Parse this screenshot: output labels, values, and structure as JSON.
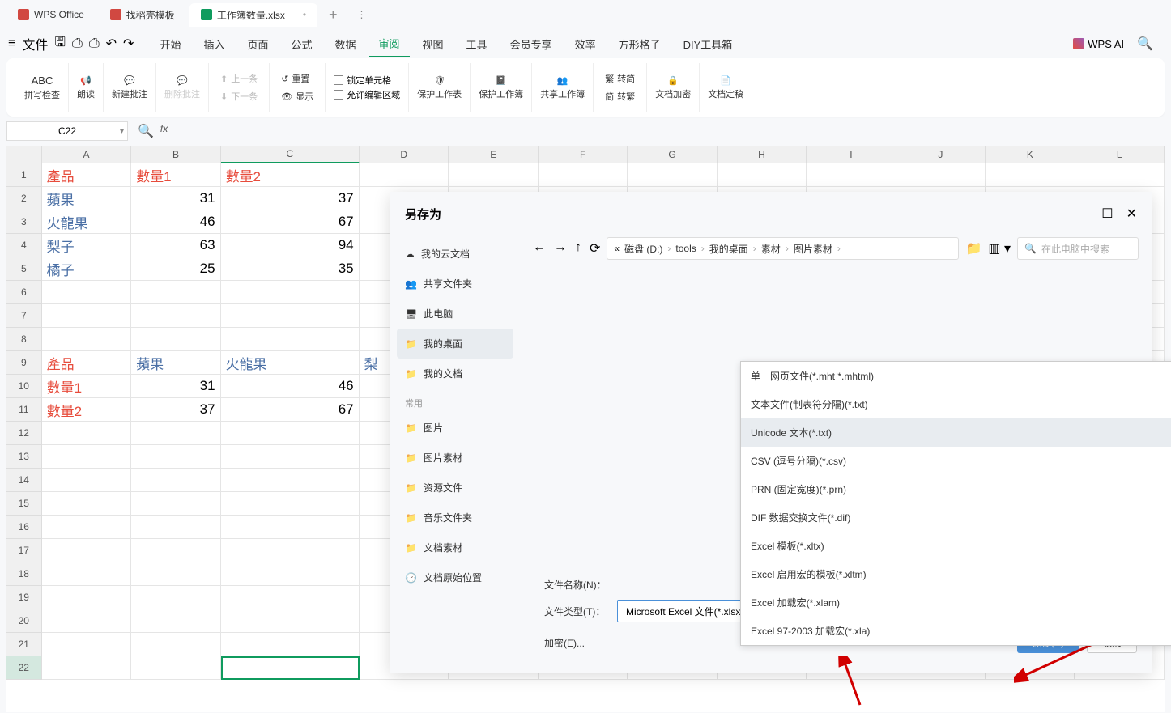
{
  "tabs": {
    "wps_office": "WPS Office",
    "template": "找稻壳模板",
    "workbook": "工作簿数量.xlsx"
  },
  "menu": {
    "file": "文件",
    "items": [
      "开始",
      "插入",
      "页面",
      "公式",
      "数据",
      "审阅",
      "视图",
      "工具",
      "会员专享",
      "效率",
      "方形格子",
      "DIY工具箱"
    ],
    "wps_ai": "WPS AI"
  },
  "ribbon": {
    "spellcheck": "拼写检查",
    "read": "朗读",
    "new_comment": "新建批注",
    "del_comment": "删除批注",
    "prev": "上一条",
    "next": "下一条",
    "reset": "重置",
    "show": "显示",
    "lock_cell": "锁定单元格",
    "allow_edit": "允许编辑区域",
    "protect_sheet": "保护工作表",
    "protect_book": "保护工作簿",
    "share_book": "共享工作簿",
    "to_simp": "转简",
    "to_trad": "转繁",
    "encrypt_doc": "文档加密",
    "finalize": "文档定稿"
  },
  "name_box": "C22",
  "columns": [
    "A",
    "B",
    "C",
    "D",
    "E",
    "F",
    "G",
    "H",
    "I",
    "J",
    "K",
    "L"
  ],
  "sheet_data": {
    "r1": {
      "a": "產品",
      "b": "數量1",
      "c": "數量2"
    },
    "r2": {
      "a": "蘋果",
      "b": "31",
      "c": "37"
    },
    "r3": {
      "a": "火龍果",
      "b": "46",
      "c": "67"
    },
    "r4": {
      "a": "梨子",
      "b": "63",
      "c": "94"
    },
    "r5": {
      "a": "橘子",
      "b": "25",
      "c": "35"
    },
    "r9": {
      "a": "產品",
      "b": "蘋果",
      "c": "火龍果",
      "d": "梨"
    },
    "r10": {
      "a": "數量1",
      "b": "31",
      "c": "46"
    },
    "r11": {
      "a": "數量2",
      "b": "37",
      "c": "67"
    }
  },
  "dialog": {
    "title": "另存为",
    "close": "×",
    "sidebar": {
      "cloud": "我的云文档",
      "share": "共享文件夹",
      "pc": "此电脑",
      "desktop": "我的桌面",
      "docs": "我的文档",
      "common_header": "常用",
      "pictures": "图片",
      "pic_mat": "图片素材",
      "res": "资源文件",
      "music": "音乐文件夹",
      "doc_mat": "文档素材",
      "orig": "文档原始位置"
    },
    "breadcrumb": [
      "磁盘 (D:)",
      "tools",
      "我的桌面",
      "素材",
      "图片素材"
    ],
    "bc_prefix": "«",
    "search_placeholder": "在此电脑中搜索",
    "file_types": {
      "mht": "单一网页文件(*.mht *.mhtml)",
      "txt_tab": "文本文件(制表符分隔)(*.txt)",
      "unicode": "Unicode 文本(*.txt)",
      "csv": "CSV (逗号分隔)(*.csv)",
      "prn": "PRN (固定宽度)(*.prn)",
      "dif": "DIF 数据交换文件(*.dif)",
      "xltx": "Excel 模板(*.xltx)",
      "xltm": "Excel 启用宏的模板(*.xltm)",
      "xlam": "Excel 加载宏(*.xlam)",
      "xla": "Excel 97-2003 加载宏(*.xla)"
    },
    "filename_label": "文件名称(N)：",
    "filetype_label": "文件类型(T)：",
    "filetype_selected": "Microsoft Excel 文件(*.xlsx)",
    "encrypt": "加密(E)...",
    "save": "保存(S)",
    "cancel": "取消"
  }
}
